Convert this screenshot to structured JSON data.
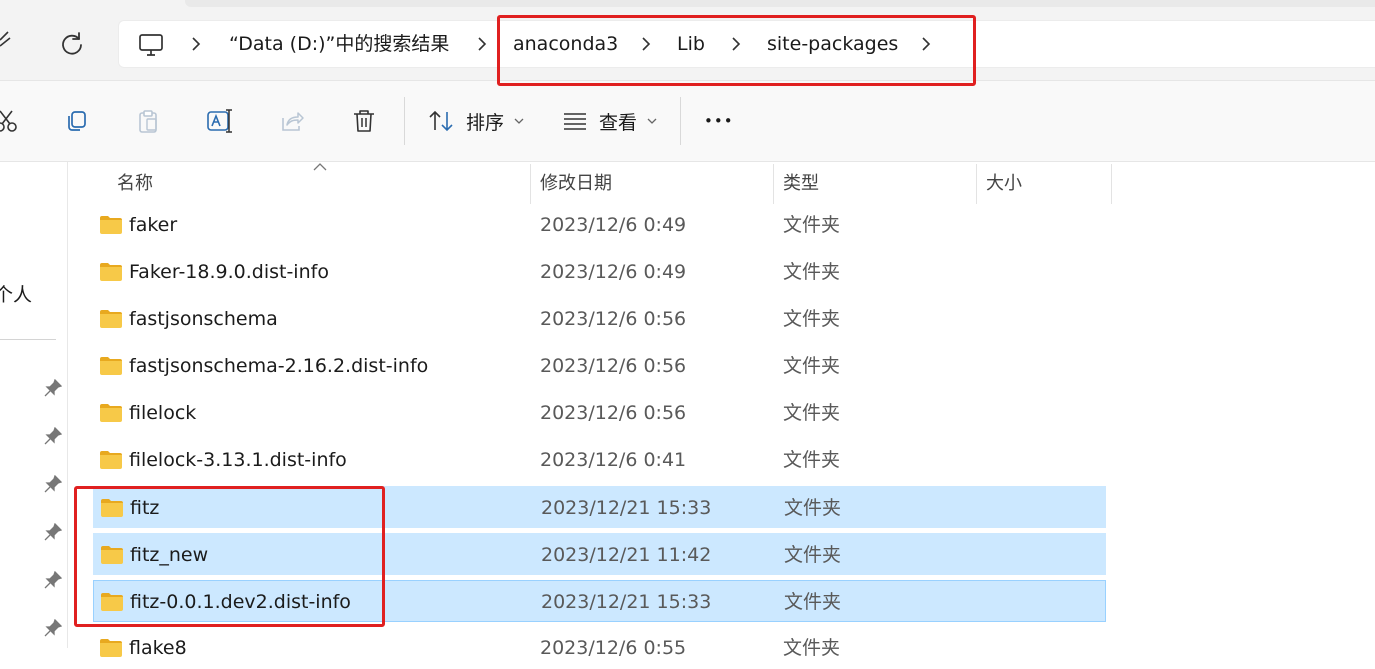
{
  "address_bar": {
    "crumbs": [
      "“Data (D:)”中的搜索结果",
      "anaconda3",
      "Lib",
      "site-packages"
    ]
  },
  "toolbar": {
    "sort_label": "排序",
    "view_label": "查看",
    "more_label": "•••"
  },
  "sidebar": {
    "label": "个人"
  },
  "columns": {
    "name": "名称",
    "date": "修改日期",
    "type": "类型",
    "size": "大小"
  },
  "files": [
    {
      "name": "faker",
      "date": "2023/12/6 0:49",
      "type": "文件夹"
    },
    {
      "name": "Faker-18.9.0.dist-info",
      "date": "2023/12/6 0:49",
      "type": "文件夹"
    },
    {
      "name": "fastjsonschema",
      "date": "2023/12/6 0:56",
      "type": "文件夹"
    },
    {
      "name": "fastjsonschema-2.16.2.dist-info",
      "date": "2023/12/6 0:56",
      "type": "文件夹"
    },
    {
      "name": "filelock",
      "date": "2023/12/6 0:56",
      "type": "文件夹"
    },
    {
      "name": "filelock-3.13.1.dist-info",
      "date": "2023/12/6 0:41",
      "type": "文件夹"
    },
    {
      "name": "fitz",
      "date": "2023/12/21 15:33",
      "type": "文件夹"
    },
    {
      "name": "fitz_new",
      "date": "2023/12/21 11:42",
      "type": "文件夹"
    },
    {
      "name": "fitz-0.0.1.dev2.dist-info",
      "date": "2023/12/21 15:33",
      "type": "文件夹"
    },
    {
      "name": "flake8",
      "date": "2023/12/6 0:55",
      "type": "文件夹"
    }
  ],
  "colors": {
    "selection": "#cce8ff",
    "selection_border": "#99d1ff",
    "annotation": "#e02020",
    "folder": "#f7c948"
  }
}
